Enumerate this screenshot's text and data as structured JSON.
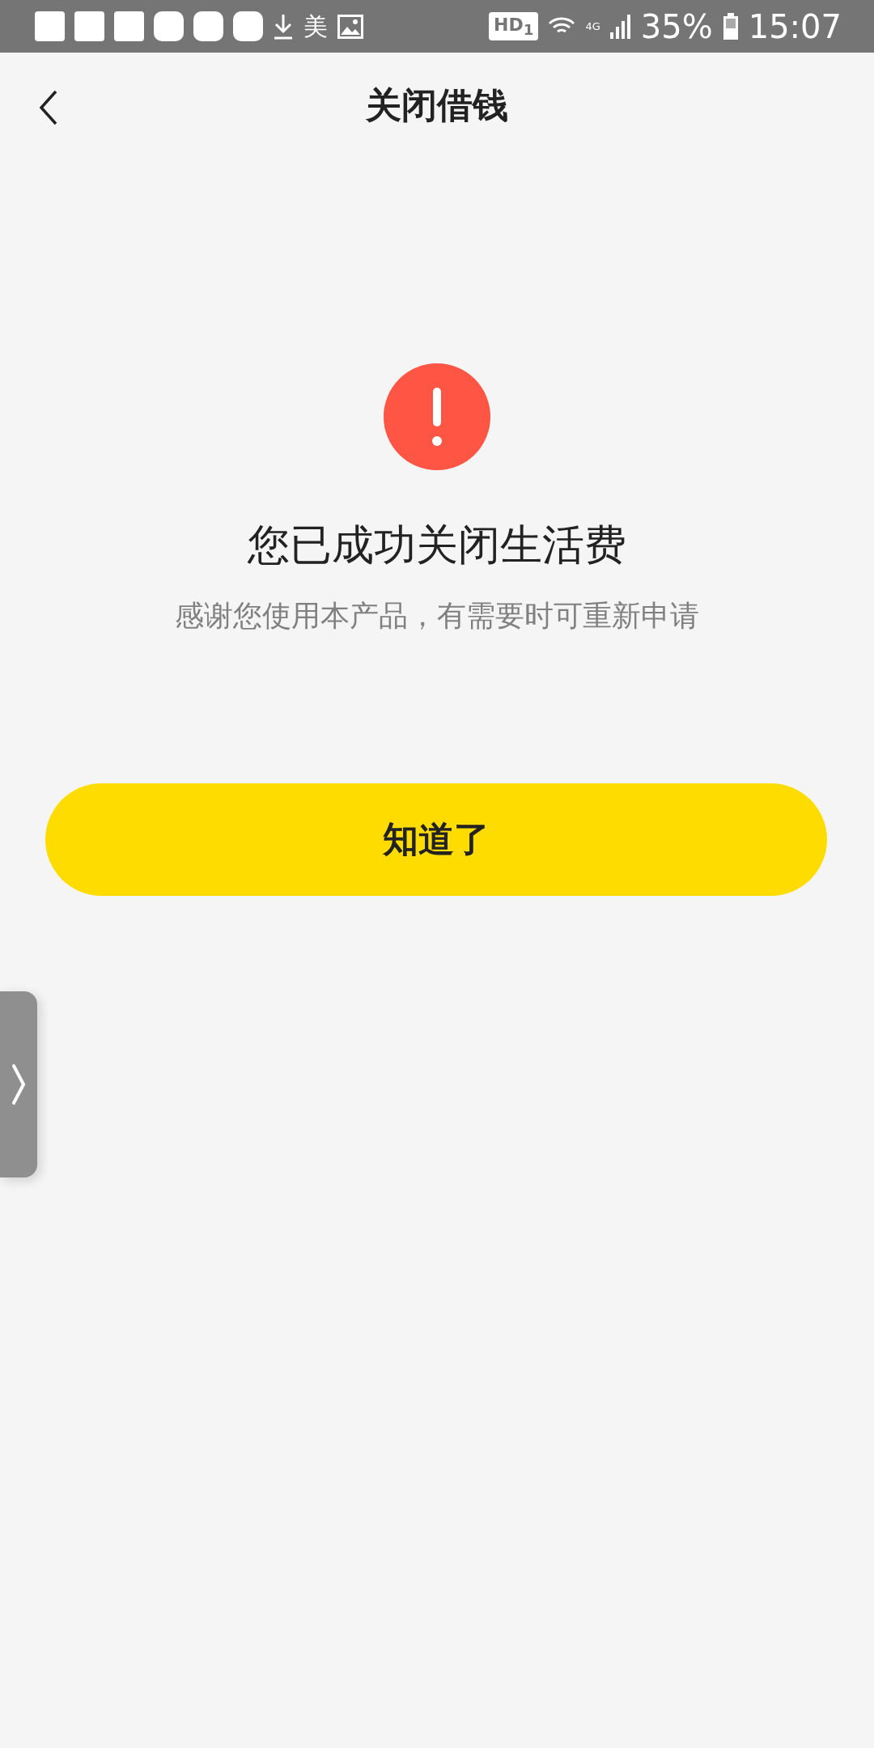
{
  "status_bar": {
    "notification_glyph": "美",
    "hd_badge": "HD$_{1}$",
    "network": "4G",
    "battery": "35%",
    "time": "15:07"
  },
  "header": {
    "title": "关闭借钱"
  },
  "result": {
    "title": "您已成功关闭生活费",
    "message": "感谢您使用本产品，有需要时可重新申请"
  },
  "button": {
    "label": "知道了"
  }
}
